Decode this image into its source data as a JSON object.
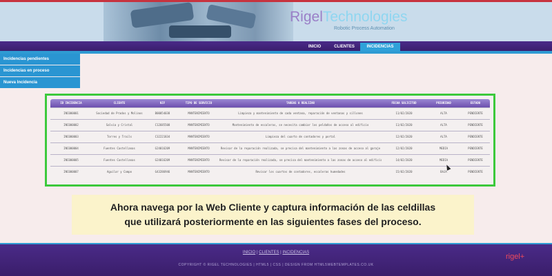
{
  "header": {
    "logo_main": "Rigel",
    "logo_accent": "Technologies",
    "tagline": "Robotic Process Automation"
  },
  "nav": {
    "tabs": [
      "INICIO",
      "CLIENTES",
      "INCIDENCIAS"
    ],
    "active": "INCIDENCIAS"
  },
  "sidebar": {
    "items": [
      "Incidencias pendientes",
      "Incidencias en proceso",
      "Nueva Incidencia"
    ]
  },
  "table": {
    "columns": [
      "ID INCIDENCIA",
      "CLIENTE",
      "NIF",
      "TIPO DE SERVICIO",
      "TAREAS A REALIZAR",
      "FECHA SOLICITUD",
      "PRIORIDAD",
      "ESTADO"
    ],
    "rows": [
      [
        "INC000001",
        "Sociedad de Prados y Molinos",
        "B00054038",
        "MANTENIMIENTO",
        "Limpieza y mantenimiento de cada ventana, reparación de ventanas y sillones",
        "11/02/2020",
        "ALTA",
        "PENDIENTE"
      ],
      [
        "INC000002",
        "Salvia y Cristal",
        "C12685508",
        "MANTENIMIENTO",
        "Mantenimiento de escaleras, se necesita cambiar los peldaños de acceso al edificio",
        "11/02/2020",
        "ALTA",
        "PENDIENTE"
      ],
      [
        "INC000003",
        "Torres y Trails",
        "C32221834",
        "MANTENIMIENTO",
        "Limpieza del cuarto de contadores y portal",
        "12/02/2020",
        "ALTA",
        "PENDIENTE"
      ],
      [
        "INC000004",
        "Fuentes Castellanas",
        "G24016209",
        "MANTENIMIENTO",
        "Revisar de la reparación realizada, se precisa del mantenimiento a las zonas de acceso al garaje",
        "12/02/2020",
        "MEDIA",
        "PENDIENTE"
      ],
      [
        "INC000005",
        "Fuentes Castellanas",
        "G24016209",
        "MANTENIMIENTO",
        "Revisar de la reparación realizada, se precisa del mantenimiento a las zonas de acceso al edificio",
        "14/02/2020",
        "MEDIA",
        "PENDIENTE"
      ],
      [
        "INC000007",
        "Aguilar y Campo",
        "G43286946",
        "MANTENIMIENTO",
        "Revisar los cuartos de contadores, escaleras humedades",
        "15/02/2020",
        "BAJA",
        "PENDIENTE"
      ]
    ]
  },
  "caption": {
    "line1": "Ahora navega por la Web Cliente y captura información de las celdillas",
    "line2": "que utilizará posteriormente en las siguientes fases del proceso."
  },
  "footer": {
    "links": [
      "INICIO",
      "CLIENTES",
      "INCIDENCIAS"
    ],
    "separator": "|",
    "copyright": "COPYRIGHT © RIGEL TECHNOLOGIES | HTML5 | CSS | DESIGN FROM HTML5WEBTEMPLATES.CO.UK",
    "logo": "rigel+"
  },
  "colors": {
    "nav_purple": "#4a2a88",
    "accent_blue": "#2f9bd3",
    "highlight_green": "#3cc93c",
    "caption_bg": "#fbf3cb"
  }
}
